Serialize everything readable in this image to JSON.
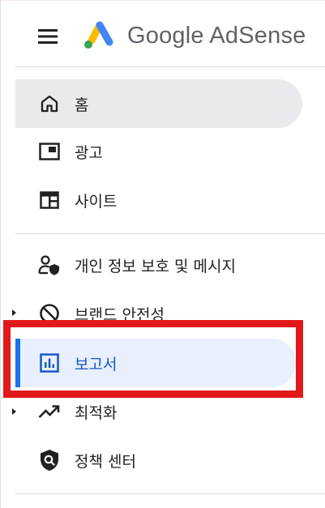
{
  "header": {
    "menu_icon": "menu-icon",
    "brand_name": "Google AdSense",
    "logo_colors": [
      "#fbbc04",
      "#34a853",
      "#4285f4"
    ]
  },
  "nav": {
    "items": [
      {
        "label": "홈",
        "icon": "home-icon",
        "selected": true
      },
      {
        "label": "광고",
        "icon": "ads-icon"
      },
      {
        "label": "사이트",
        "icon": "sites-icon"
      },
      {
        "label": "개인 정보 보호 및 메시지",
        "icon": "privacy-messaging-icon"
      },
      {
        "label": "브랜드 안전성",
        "icon": "block-icon",
        "expandable": true
      },
      {
        "label": "보고서",
        "icon": "reports-icon",
        "current": true
      },
      {
        "label": "최적화",
        "icon": "trending-up-icon",
        "expandable": true
      },
      {
        "label": "정책 센터",
        "icon": "policy-shield-icon"
      }
    ]
  },
  "colors": {
    "accent": "#1a73e8",
    "selected_bg": "#e8eaed",
    "current_bg": "#e8f0fe",
    "highlight": "#e2191b",
    "divider": "#dadce0"
  }
}
